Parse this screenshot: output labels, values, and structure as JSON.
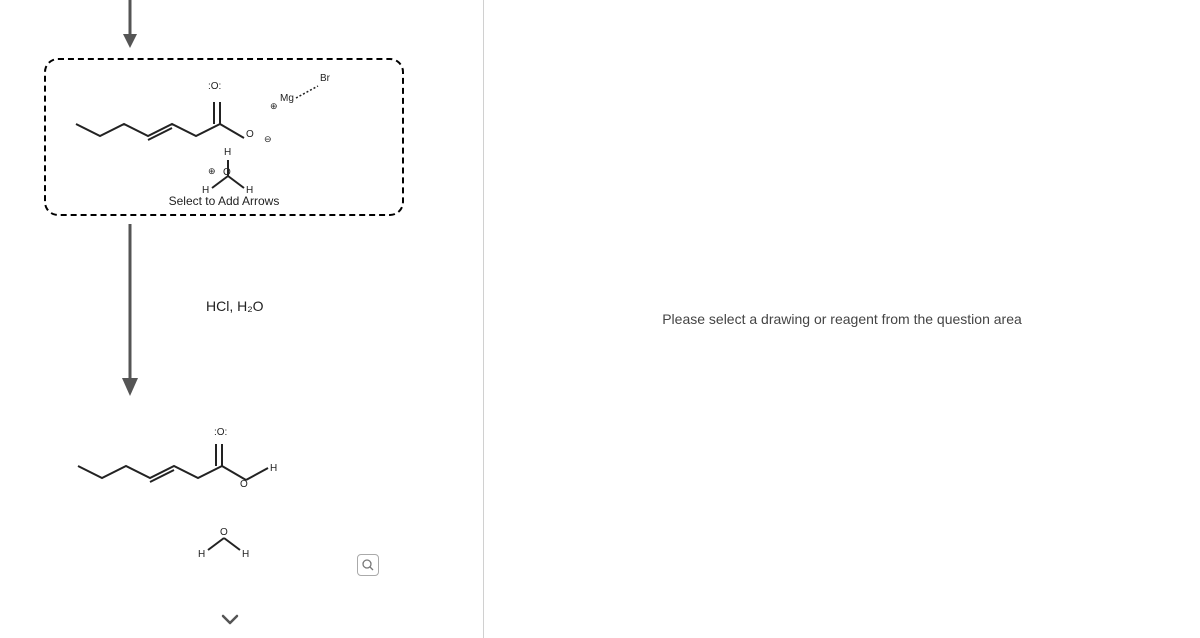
{
  "rightPanel": {
    "placeholderText": "Please select a drawing or reagent from the question area"
  },
  "reactionBox": {
    "caption": "Select to Add Arrows",
    "labels": {
      "o_dbl_top": ":O:",
      "o_neg": "O",
      "mg": "Mg",
      "br": "Br",
      "h_top": "H",
      "h_left": "H",
      "h_right": "H",
      "o_h3o": "O",
      "plus": "⊕",
      "minus": "⊖"
    }
  },
  "reagent": {
    "text": "HCl, H₂O"
  },
  "productBox": {
    "labels": {
      "o_dbl": ":O:",
      "o_neg": "O",
      "h_right": "H",
      "h_w1": "H",
      "h_w2": "H",
      "o_w": "O"
    }
  },
  "icons": {
    "zoom": "zoom-icon",
    "chevron": "chevron-down-icon"
  }
}
